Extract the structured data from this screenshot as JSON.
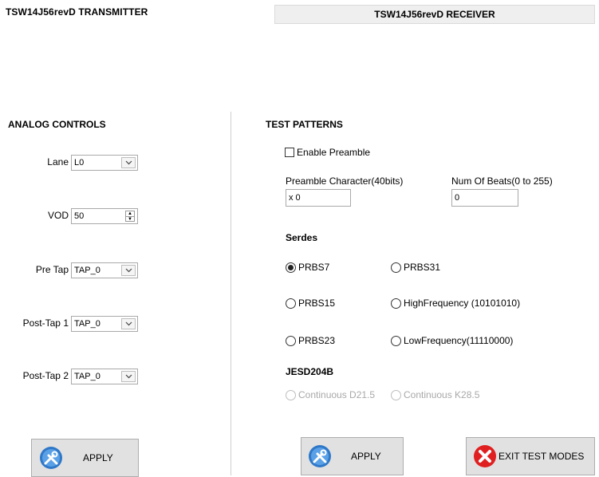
{
  "header": {
    "transmitter_title": "TSW14J56revD TRANSMITTER",
    "receiver_button": "TSW14J56revD RECEIVER"
  },
  "analog": {
    "title": "ANALOG CONTROLS",
    "lane_label": "Lane",
    "lane_value": "L0",
    "vod_label": "VOD",
    "vod_value": "50",
    "pretap_label": "Pre Tap",
    "pretap_value": "TAP_0",
    "posttap1_label": "Post-Tap 1",
    "posttap1_value": "TAP_0",
    "posttap2_label": "Post-Tap 2",
    "posttap2_value": "TAP_0",
    "apply_label": "APPLY"
  },
  "test": {
    "title": "TEST PATTERNS",
    "enable_preamble": "Enable Preamble",
    "preamble_char_label": "Preamble Character(40bits)",
    "preamble_char_value": "x 0",
    "num_beats_label": "Num Of Beats(0 to 255)",
    "num_beats_value": "0",
    "serdes_title": "Serdes",
    "prbs7": "PRBS7",
    "prbs31": "PRBS31",
    "prbs15": "PRBS15",
    "highfreq": "HighFrequency (10101010)",
    "prbs23": "PRBS23",
    "lowfreq": "LowFrequency(11110000)",
    "jesd_title": "JESD204B",
    "cont_d215": "Continuous D21.5",
    "cont_k285": "Continuous K28.5",
    "apply_label": "APPLY",
    "exit_label": "EXIT TEST MODES"
  },
  "colors": {
    "exit_icon": "#e02020",
    "apply_icon": "#2f78c8"
  }
}
